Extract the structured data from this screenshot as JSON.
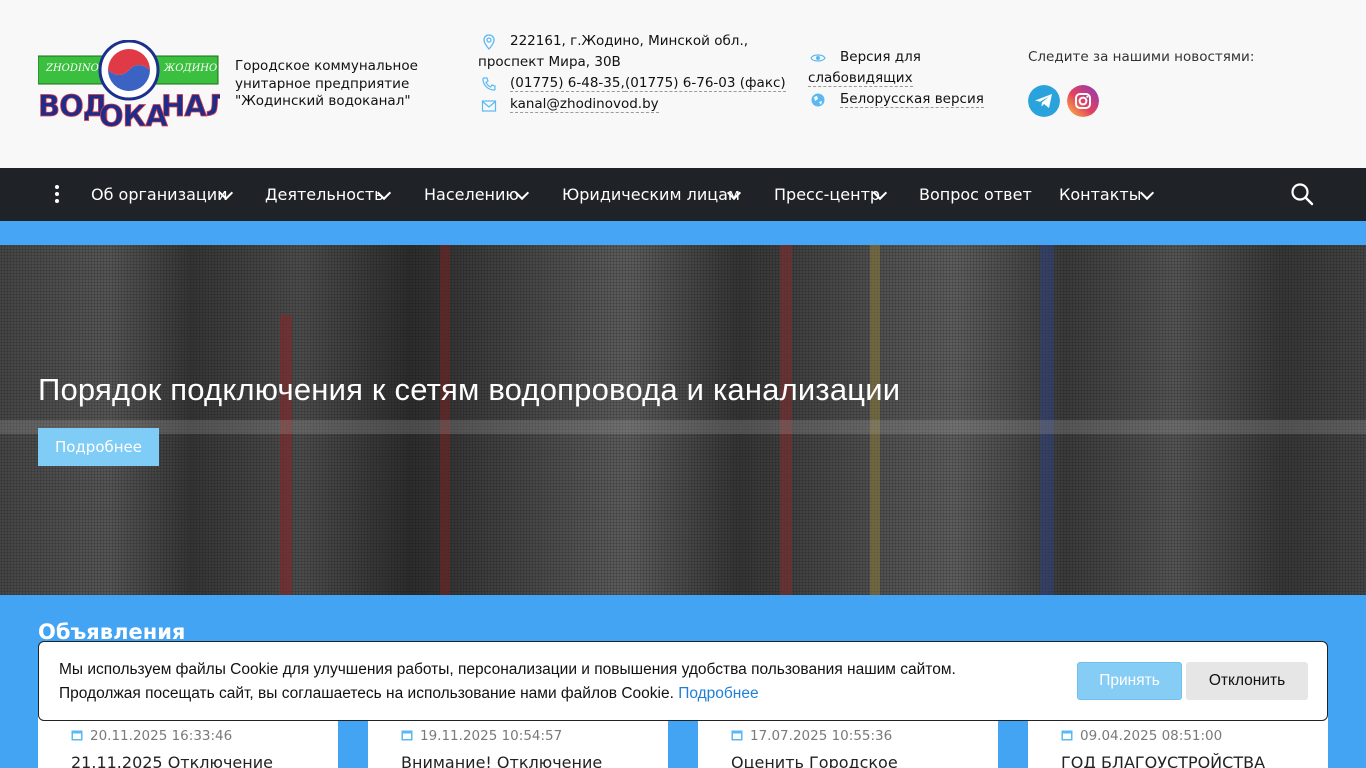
{
  "header": {
    "logo_top_text_left": "ZHODINO",
    "logo_top_text_right": "ЖОДИНО",
    "logo_word": "ВОДОКАНАЛ",
    "org_name": "Городское коммунальное\nунитарное предприятие\n\"Жодинский водоканал\"",
    "address_line1": "222161, г.Жодино, Минской обл.,",
    "address_line2": "проспект Мира, 30В",
    "phone1": "(01775) 6-48-35,",
    "phone2": "(01775) 6-76-03 (факс)",
    "email": "kanal@zhodinovod.by",
    "low_vision_line1": "Версия для",
    "low_vision_line2": "слабовидящих",
    "belarusian": "Белорусская версия",
    "follow_text": "Следите за нашими новостями:"
  },
  "nav": {
    "items": [
      {
        "label": "Об организации"
      },
      {
        "label": "Деятельность"
      },
      {
        "label": "Населению"
      },
      {
        "label": "Юридическим лицам"
      },
      {
        "label": "Пресс-центр"
      },
      {
        "label": "Вопрос ответ"
      },
      {
        "label": "Контакты"
      }
    ]
  },
  "hero": {
    "title": "Порядок подключения к сетям водопровода и канализации",
    "button": "Подробнее"
  },
  "announcements": {
    "title": "Объявления",
    "cards": [
      {
        "date": "20.11.2025 16:33:46",
        "text": "21.11.2025 Отключение"
      },
      {
        "date": "19.11.2025 10:54:57",
        "text": "Внимание! Отключение"
      },
      {
        "date": "17.07.2025 10:55:36",
        "text": "Оценить Городское"
      },
      {
        "date": "09.04.2025 08:51:00",
        "text": "ГОД БЛАГОУСТРОЙСТВА"
      }
    ]
  },
  "cookie": {
    "line1": "Мы используем файлы Cookie для улучшения работы, персонализации и повышения удобства пользования нашим сайтом.",
    "line2": "Продолжая посещать сайт, вы соглашаетесь на использование нами файлов Cookie.",
    "link": "Подробнее",
    "accept": "Принять",
    "decline": "Отклонить"
  },
  "colors": {
    "nav_bg": "#1f2226",
    "accent_blue": "#43a4f3",
    "hero_button": "#7fcdf7",
    "icon_blue": "#5bb8f0"
  }
}
